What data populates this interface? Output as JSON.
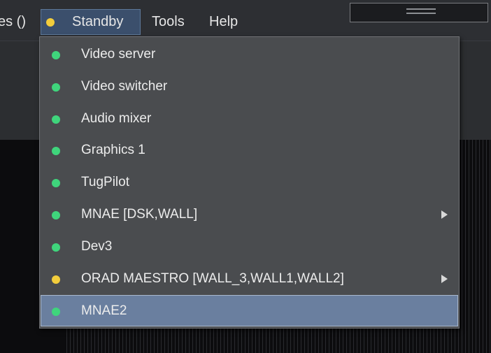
{
  "menubar": {
    "partial_label": "es ()",
    "standby": {
      "label": "Standby",
      "status_color": "#f2cd3c"
    },
    "tools_label": "Tools",
    "help_label": "Help"
  },
  "dropdown": {
    "items": [
      {
        "label": "Video server",
        "status": "green",
        "submenu": false
      },
      {
        "label": "Video switcher",
        "status": "green",
        "submenu": false
      },
      {
        "label": "Audio mixer",
        "status": "green",
        "submenu": false
      },
      {
        "label": "Graphics 1",
        "status": "green",
        "submenu": false
      },
      {
        "label": "TugPilot",
        "status": "green",
        "submenu": false
      },
      {
        "label": "MNAE [DSK,WALL]",
        "status": "green",
        "submenu": true
      },
      {
        "label": "Dev3",
        "status": "green",
        "submenu": false
      },
      {
        "label": "ORAD MAESTRO [WALL_3,WALL1,WALL2]",
        "status": "yellow",
        "submenu": true
      },
      {
        "label": "MNAE2",
        "status": "green",
        "submenu": false,
        "selected": true
      }
    ]
  },
  "colors": {
    "status_green": "#3fd57c",
    "status_yellow": "#f2cd3c",
    "selection": "#6a7f9f"
  },
  "icons": {
    "status": "status-dot-icon",
    "submenu": "submenu-arrow-icon"
  }
}
